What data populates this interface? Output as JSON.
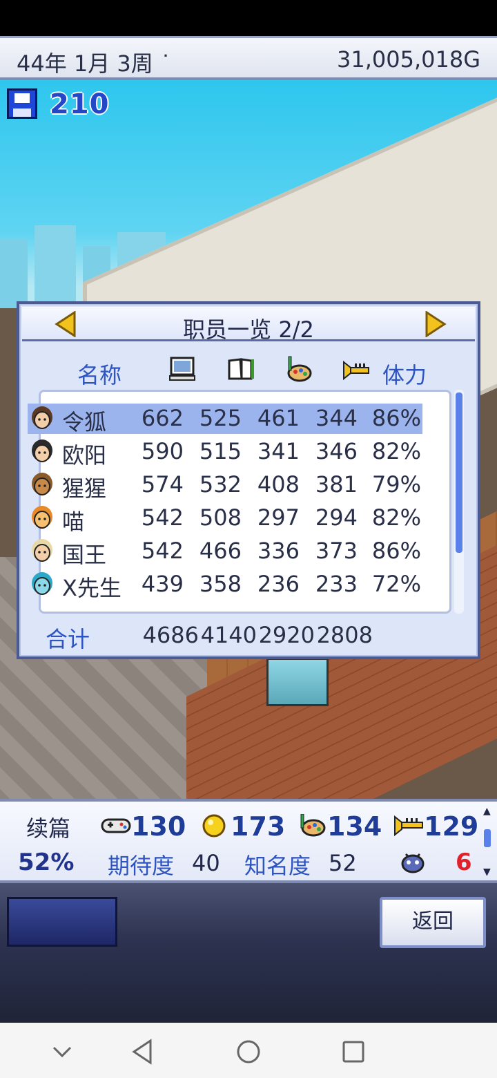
{
  "topbar": {
    "date": "44年 1月 3周 ˙",
    "money": "31,005,018G"
  },
  "save": {
    "count": "210",
    "icon": "floppy-disk-icon"
  },
  "panel": {
    "title": "职员一览 2/2",
    "prev_icon": "arrow-left-icon",
    "next_icon": "arrow-right-icon",
    "headers": {
      "name": "名称",
      "programming_icon": "computer-icon",
      "scenario_icon": "book-icon",
      "graphics_icon": "palette-icon",
      "sound_icon": "trumpet-icon",
      "stamina": "体力"
    },
    "staff": [
      {
        "name": "令狐",
        "programming": "662",
        "scenario": "525",
        "graphics": "461",
        "sound": "344",
        "stamina": "86%",
        "selected": true
      },
      {
        "name": "欧阳",
        "programming": "590",
        "scenario": "515",
        "graphics": "341",
        "sound": "346",
        "stamina": "82%"
      },
      {
        "name": "猩猩",
        "programming": "574",
        "scenario": "532",
        "graphics": "408",
        "sound": "381",
        "stamina": "79%"
      },
      {
        "name": "喵",
        "programming": "542",
        "scenario": "508",
        "graphics": "297",
        "sound": "294",
        "stamina": "82%"
      },
      {
        "name": "国王",
        "programming": "542",
        "scenario": "466",
        "graphics": "336",
        "sound": "373",
        "stamina": "86%"
      },
      {
        "name": "X先生",
        "programming": "439",
        "scenario": "358",
        "graphics": "236",
        "sound": "233",
        "stamina": "72%"
      }
    ],
    "totals": {
      "label": "合计",
      "programming": "4686",
      "scenario": "4140",
      "graphics": "2920",
      "sound": "2808"
    }
  },
  "project": {
    "genre": "续篇",
    "progress": "52%",
    "fun": "130",
    "creativity": "173",
    "graphics": "134",
    "sound": "129",
    "expectation_label": "期待度",
    "expectation": "40",
    "fame_label": "知名度",
    "fame": "52",
    "bugs": "6"
  },
  "buttons": {
    "back": "返回"
  },
  "colors": {
    "accent": "#2d54c0",
    "panel_border": "#4a5a92",
    "selection": "#9cb4ee",
    "bug": "#e0202a"
  }
}
